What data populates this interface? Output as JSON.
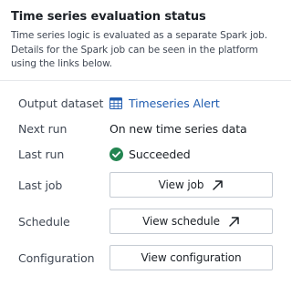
{
  "panel": {
    "title": "Time series evaluation status",
    "description": "Time series logic is evaluated as a separate Spark job. Details for the Spark job can be seen in the platform using the links below."
  },
  "rows": {
    "output_dataset": {
      "label": "Output dataset",
      "value": "Timeseries Alert",
      "icon": "table-icon"
    },
    "next_run": {
      "label": "Next run",
      "value": "On new time series data"
    },
    "last_run": {
      "label": "Last run",
      "value": "Succeeded",
      "icon": "check-circle-icon"
    },
    "last_job": {
      "label": "Last job",
      "button": "View job",
      "icon": "arrow-top-right-icon"
    },
    "schedule": {
      "label": "Schedule",
      "button": "View schedule",
      "icon": "arrow-top-right-icon"
    },
    "configuration": {
      "label": "Configuration",
      "button": "View configuration"
    }
  },
  "colors": {
    "link": "#215db0",
    "success": "#238551",
    "border": "#c5cbd3",
    "text": "#1c2127",
    "muted_text": "#404854"
  }
}
